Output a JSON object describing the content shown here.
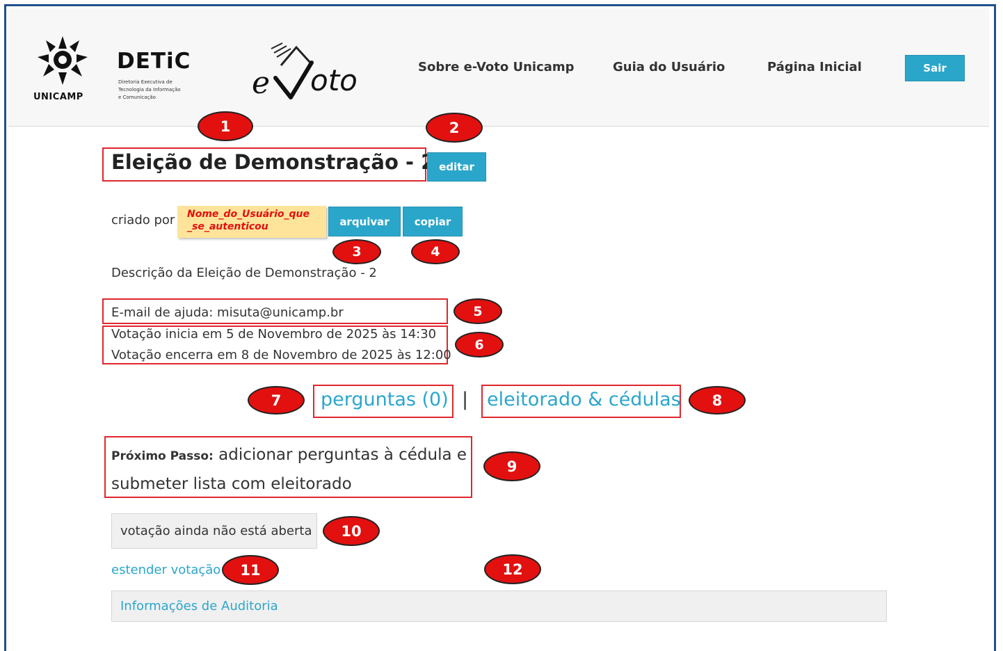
{
  "header": {
    "unicamp_logo_text": "UNICAMP",
    "detic_logo_text": "DETiC",
    "detic_subtitle_1": "Diretoria Executiva de",
    "detic_subtitle_2": "Tecnologia da Informação",
    "detic_subtitle_3": "e Comunicação",
    "evoto_logo_text": "e-Voto",
    "nav": {
      "about": "Sobre e-Voto Unicamp",
      "guide": "Guia do Usuário",
      "home": "Página Inicial"
    },
    "logout_label": "Sair"
  },
  "election": {
    "title": "Eleição de Demonstração - 2",
    "edit_label": "editar",
    "created_by_label": "criado por",
    "user_placeholder_line1": "Nome_do_Usuário_que",
    "user_placeholder_line2": "_se_autenticou",
    "archive_label": "arquivar",
    "copy_label": "copiar",
    "description": "Descrição da Eleição de Demonstração - 2",
    "help_email": "E-mail de ajuda: misuta@unicamp.br",
    "voting_start": "Votação inicia em 5 de Novembro de 2025 às 14:30",
    "voting_end": "Votação encerra em 8 de Novembro de 2025 às 12:00",
    "questions_link": "perguntas (0)",
    "separator": "|",
    "voters_link": "eleitorado & cédulas",
    "next_step_label": "Próximo Passo:",
    "next_step_line1": "adicionar perguntas à cédula e",
    "next_step_line2": "submeter lista com eleitorado",
    "voting_status": "votação ainda não está aberta",
    "extend_link": "estender votação",
    "audit_info": "Informações de Auditoria"
  },
  "callouts": [
    "1",
    "2",
    "3",
    "4",
    "5",
    "6",
    "7",
    "8",
    "9",
    "10",
    "11",
    "12"
  ],
  "colors": {
    "accent": "#2ba6cb",
    "callout": "#e31010",
    "highlight_box": "#e0262d",
    "placeholder_bg": "#fde49a",
    "frame": "#1f4e8c"
  }
}
